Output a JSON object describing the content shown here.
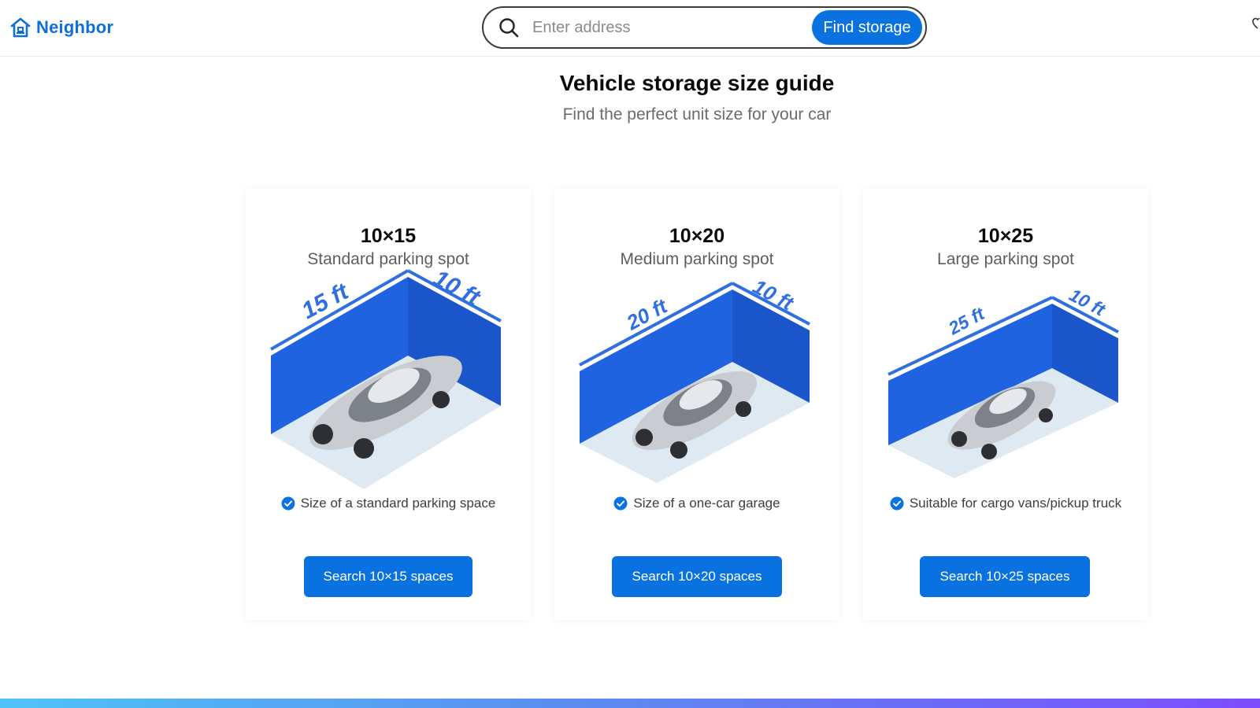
{
  "header": {
    "logo_text": "Neighbor",
    "search_placeholder": "Enter address",
    "find_button": "Find storage"
  },
  "page": {
    "title": "Vehicle storage size guide",
    "subtitle": "Find the perfect unit size for your car"
  },
  "colors": {
    "brand": "#0a72e0",
    "wall": "#1f63e0",
    "floor": "#dfe9f2"
  },
  "cards": [
    {
      "size": "10×15",
      "description": "Standard parking spot",
      "length_label": "15 ft",
      "width_label": "10 ft",
      "feature": "Size of a standard parking space",
      "button": "Search 10×15 spaces"
    },
    {
      "size": "10×20",
      "description": "Medium parking spot",
      "length_label": "20 ft",
      "width_label": "10 ft",
      "feature": "Size of a one-car garage",
      "button": "Search 10×20 spaces"
    },
    {
      "size": "10×25",
      "description": "Large parking spot",
      "length_label": "25 ft",
      "width_label": "10 ft",
      "feature": "Suitable for cargo vans/pickup truck",
      "button": "Search 10×25 spaces"
    }
  ]
}
